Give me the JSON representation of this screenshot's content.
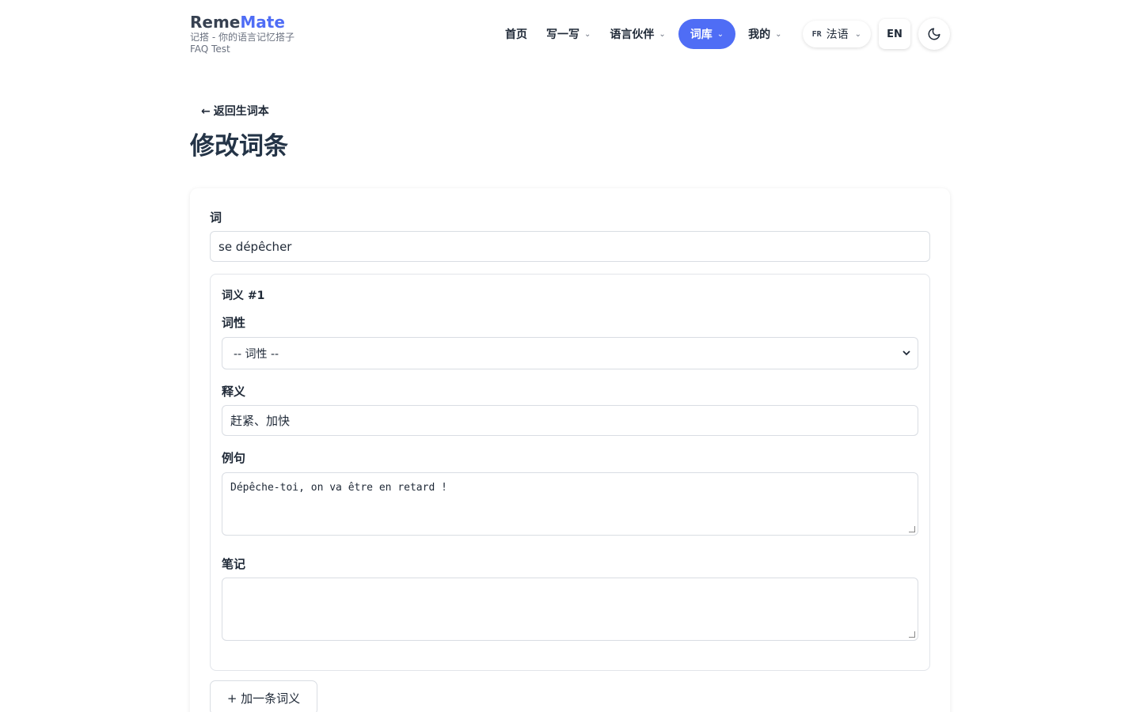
{
  "brand": {
    "name_part1": "Reme",
    "name_part2": "Mate",
    "tagline": "记搭 - 你的语言记忆搭子",
    "user": "FAQ Test"
  },
  "nav": {
    "home": "首页",
    "write": "写一写",
    "partner": "语言伙伴",
    "lexicon": "词库",
    "mine": "我的",
    "lang_code": "FR",
    "lang_name": "法语",
    "ui_lang": "EN",
    "chevron": "⌵"
  },
  "page": {
    "back_arrow": "←",
    "back_label": "返回生词本",
    "title": "修改词条"
  },
  "form": {
    "word_label": "词",
    "word_value": "se dépêcher",
    "sense_heading": "词义 #1",
    "pos_label": "词性",
    "pos_selected": "-- 词性 --",
    "definition_label": "释义",
    "definition_value": "赶紧、加快",
    "example_label": "例句",
    "example_value": "Dépêche-toi, on va être en retard !",
    "notes_label": "笔记",
    "notes_value": "",
    "add_sense_label": "+ 加一条词义"
  },
  "colors": {
    "accent": "#4f6df5",
    "text": "#1f2937",
    "title": "#243447"
  },
  "icons": {
    "theme": "moon-icon",
    "back": "arrow-left-icon",
    "select": "chevron-down-icon"
  }
}
